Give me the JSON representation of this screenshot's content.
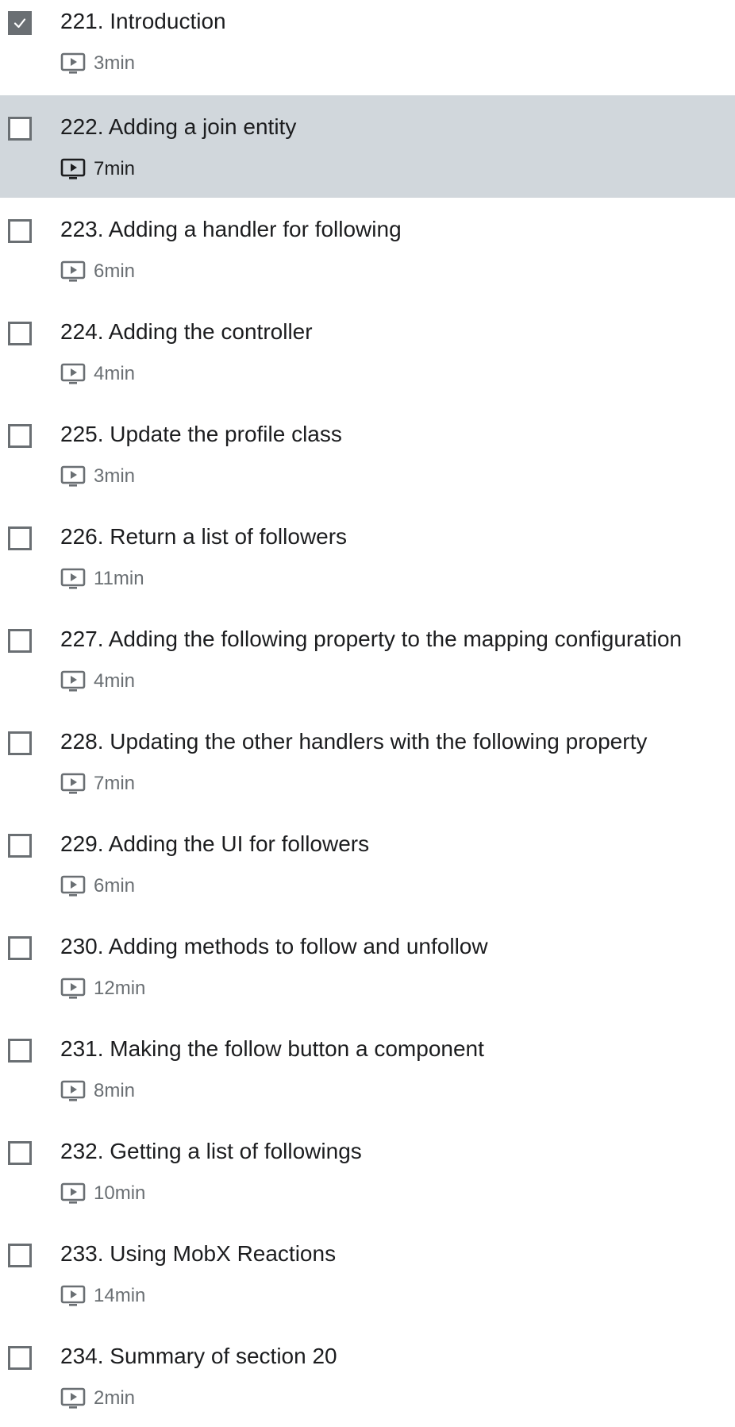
{
  "icons": {
    "checkbox_checked": "check-icon",
    "lecture_type": "video-icon"
  },
  "colors": {
    "active_row_bg": "#d1d7dc",
    "checkbox_border": "#6a6f73",
    "title_text": "#1c1d1f",
    "meta_text": "#6a6f73"
  },
  "lectures": [
    {
      "title": "221. Introduction",
      "duration": "3min",
      "completed": true,
      "active": false
    },
    {
      "title": "222. Adding a join entity",
      "duration": "7min",
      "completed": false,
      "active": true
    },
    {
      "title": "223. Adding a handler for following",
      "duration": "6min",
      "completed": false,
      "active": false
    },
    {
      "title": "224. Adding the controller",
      "duration": "4min",
      "completed": false,
      "active": false
    },
    {
      "title": "225. Update the profile class",
      "duration": "3min",
      "completed": false,
      "active": false
    },
    {
      "title": "226. Return a list of followers",
      "duration": "11min",
      "completed": false,
      "active": false
    },
    {
      "title": "227. Adding the following property to the mapping configuration",
      "duration": "4min",
      "completed": false,
      "active": false
    },
    {
      "title": "228. Updating the other handlers with the following property",
      "duration": "7min",
      "completed": false,
      "active": false
    },
    {
      "title": "229. Adding the UI for followers",
      "duration": "6min",
      "completed": false,
      "active": false
    },
    {
      "title": "230. Adding methods to follow and unfollow",
      "duration": "12min",
      "completed": false,
      "active": false
    },
    {
      "title": "231. Making the follow button a component",
      "duration": "8min",
      "completed": false,
      "active": false
    },
    {
      "title": "232. Getting a list of followings",
      "duration": "10min",
      "completed": false,
      "active": false
    },
    {
      "title": "233. Using MobX Reactions",
      "duration": "14min",
      "completed": false,
      "active": false
    },
    {
      "title": "234. Summary of section 20",
      "duration": "2min",
      "completed": false,
      "active": false
    }
  ]
}
